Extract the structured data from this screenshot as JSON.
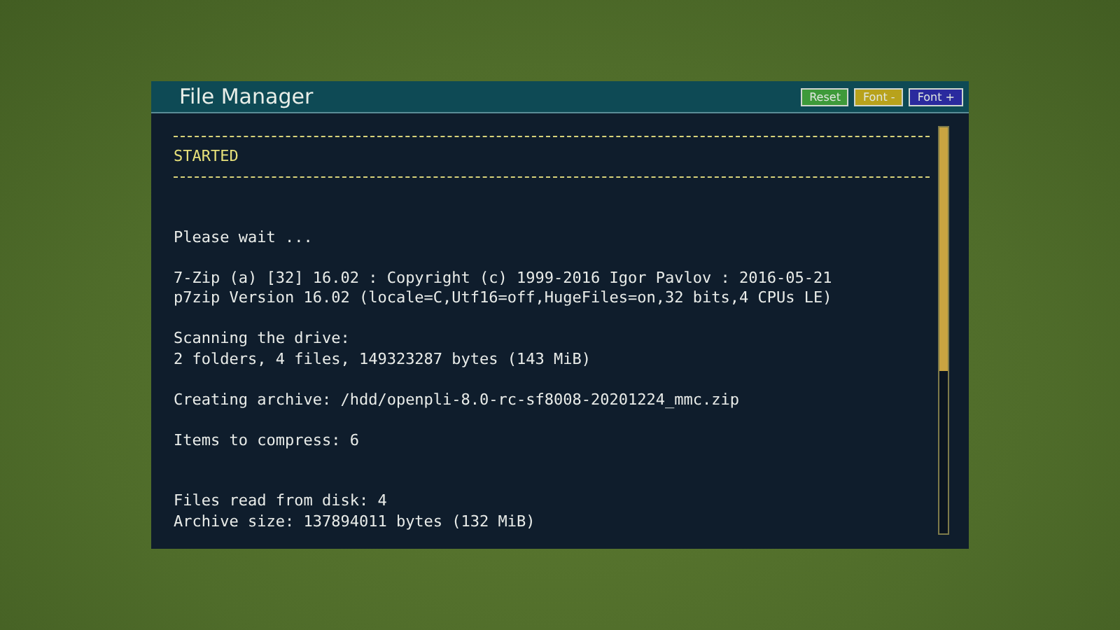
{
  "window": {
    "title": "File Manager"
  },
  "buttons": [
    {
      "label": "Reset",
      "color": "#3e9a3a"
    },
    {
      "label": "Font -",
      "color": "#b8a21c"
    },
    {
      "label": "Font +",
      "color": "#2a2a9e"
    }
  ],
  "console": [
    {
      "kind": "rule"
    },
    {
      "kind": "status",
      "text": "STARTED"
    },
    {
      "kind": "rule"
    },
    {
      "kind": "blank"
    },
    {
      "kind": "blank"
    },
    {
      "kind": "text",
      "text": "Please wait ..."
    },
    {
      "kind": "blank"
    },
    {
      "kind": "text",
      "text": "7-Zip (a) [32] 16.02 : Copyright (c) 1999-2016 Igor Pavlov : 2016-05-21"
    },
    {
      "kind": "text",
      "text": "p7zip Version 16.02 (locale=C,Utf16=off,HugeFiles=on,32 bits,4 CPUs LE)"
    },
    {
      "kind": "blank"
    },
    {
      "kind": "text",
      "text": "Scanning the drive:"
    },
    {
      "kind": "text",
      "text": "2 folders, 4 files, 149323287 bytes (143 MiB)"
    },
    {
      "kind": "blank"
    },
    {
      "kind": "text",
      "text": "Creating archive: /hdd/openpli-8.0-rc-sf8008-20201224_mmc.zip"
    },
    {
      "kind": "blank"
    },
    {
      "kind": "text",
      "text": "Items to compress: 6"
    },
    {
      "kind": "blank"
    },
    {
      "kind": "blank"
    },
    {
      "kind": "text",
      "text": "Files read from disk: 4"
    },
    {
      "kind": "text",
      "text": "Archive size: 137894011 bytes (132 MiB)"
    }
  ]
}
